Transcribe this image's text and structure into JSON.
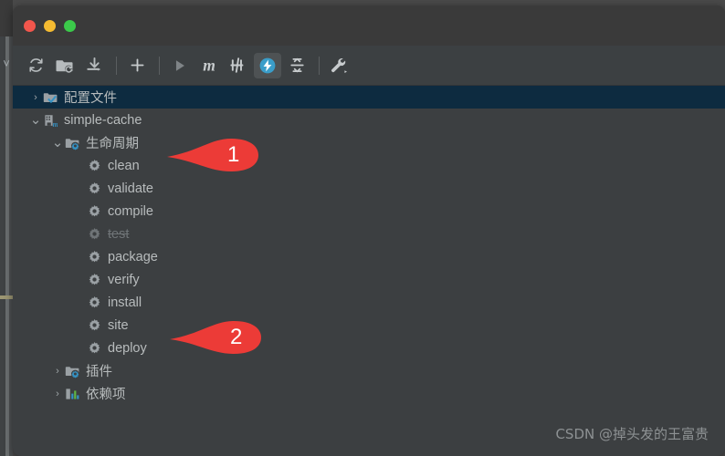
{
  "window": {
    "traffic_lights": [
      "close",
      "minimize",
      "zoom"
    ],
    "colors": {
      "close": "#f2564c",
      "minimize": "#f5bb31",
      "zoom": "#3bc94a",
      "accent": "#3592c4",
      "selection": "#0d2b40",
      "panel_bg": "#3c3f41",
      "toolbar_bg": "#3c4042",
      "titlebar_bg": "#3a3a3a",
      "annotation_red": "#ec3b37"
    }
  },
  "toolbar": {
    "buttons": [
      {
        "name": "reload-all-maven-projects",
        "icon": "refresh-icon",
        "active": false
      },
      {
        "name": "generate-sources-and-update-folders",
        "icon": "folder-refresh-icon",
        "active": false
      },
      {
        "name": "download-sources-and-documentation",
        "icon": "download-icon",
        "active": false
      },
      {
        "name": "add-maven-project",
        "icon": "plus-icon",
        "active": false
      },
      {
        "name": "run-maven-build",
        "icon": "run-triangle-icon",
        "active": false
      },
      {
        "name": "execute-maven-goal",
        "icon": "maven-m-icon",
        "active": false
      },
      {
        "name": "toggle-skip-tests",
        "icon": "skip-tests-icon",
        "active": false
      },
      {
        "name": "toggle-offline-mode",
        "icon": "offline-bolt-icon",
        "active": true
      },
      {
        "name": "collapse-all",
        "icon": "collapse-all-icon",
        "active": false
      },
      {
        "name": "maven-settings",
        "icon": "wrench-icon",
        "active": false
      }
    ]
  },
  "tree": {
    "rows": [
      {
        "label": "配置文件",
        "indent": 0,
        "twisty": "right",
        "icon": "profiles-folder-icon",
        "selected": true,
        "disabled": false
      },
      {
        "label": "simple-cache",
        "indent": 0,
        "twisty": "down",
        "icon": "maven-project-icon",
        "selected": false,
        "disabled": false
      },
      {
        "label": "生命周期",
        "indent": 1,
        "twisty": "down",
        "icon": "lifecycle-folder-icon",
        "selected": false,
        "disabled": false
      },
      {
        "label": "clean",
        "indent": 2,
        "twisty": "none",
        "icon": "goal-gear-icon",
        "selected": false,
        "disabled": false
      },
      {
        "label": "validate",
        "indent": 2,
        "twisty": "none",
        "icon": "goal-gear-icon",
        "selected": false,
        "disabled": false
      },
      {
        "label": "compile",
        "indent": 2,
        "twisty": "none",
        "icon": "goal-gear-icon",
        "selected": false,
        "disabled": false
      },
      {
        "label": "test",
        "indent": 2,
        "twisty": "none",
        "icon": "goal-gear-icon",
        "selected": false,
        "disabled": true
      },
      {
        "label": "package",
        "indent": 2,
        "twisty": "none",
        "icon": "goal-gear-icon",
        "selected": false,
        "disabled": false
      },
      {
        "label": "verify",
        "indent": 2,
        "twisty": "none",
        "icon": "goal-gear-icon",
        "selected": false,
        "disabled": false
      },
      {
        "label": "install",
        "indent": 2,
        "twisty": "none",
        "icon": "goal-gear-icon",
        "selected": false,
        "disabled": false
      },
      {
        "label": "site",
        "indent": 2,
        "twisty": "none",
        "icon": "goal-gear-icon",
        "selected": false,
        "disabled": false
      },
      {
        "label": "deploy",
        "indent": 2,
        "twisty": "none",
        "icon": "goal-gear-icon",
        "selected": false,
        "disabled": false
      },
      {
        "label": "插件",
        "indent": 1,
        "twisty": "right",
        "icon": "plugins-folder-icon",
        "selected": false,
        "disabled": false
      },
      {
        "label": "依赖项",
        "indent": 1,
        "twisty": "right",
        "icon": "dependencies-icon",
        "selected": false,
        "disabled": false
      }
    ]
  },
  "annotations": [
    {
      "name": "annotation-arrow-1",
      "number": "1",
      "points_at": "clean"
    },
    {
      "name": "annotation-arrow-2",
      "number": "2",
      "points_at": "deploy"
    }
  ],
  "watermark": {
    "text": "CSDN @掉头发的王富贵"
  }
}
